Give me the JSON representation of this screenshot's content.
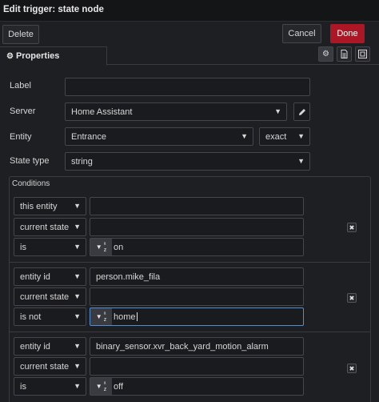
{
  "window": {
    "title": "Edit trigger: state node"
  },
  "toolbar": {
    "delete_label": "Delete",
    "cancel_label": "Cancel",
    "done_label": "Done"
  },
  "tabs": {
    "properties_label": "Properties"
  },
  "form": {
    "label_label": "Label",
    "label_value": "",
    "server_label": "Server",
    "server_value": "Home Assistant",
    "entity_label": "Entity",
    "entity_value": "Entrance",
    "entity_match": "exact",
    "state_type_label": "State type",
    "state_type_value": "string"
  },
  "conditions": {
    "title": "Conditions",
    "groups": [
      {
        "rows": [
          {
            "select": "this entity",
            "value": ""
          },
          {
            "select": "current state",
            "value": ""
          },
          {
            "select": "is",
            "value": "on",
            "type": "az"
          }
        ]
      },
      {
        "rows": [
          {
            "select": "entity id",
            "value": "person.mike_fila"
          },
          {
            "select": "current state",
            "value": ""
          },
          {
            "select": "is not",
            "value": "home",
            "type": "az"
          }
        ]
      },
      {
        "rows": [
          {
            "select": "entity id",
            "value": "binary_sensor.xvr_back_yard_motion_alarm"
          },
          {
            "select": "current state",
            "value": ""
          },
          {
            "select": "is",
            "value": "off",
            "type": "az"
          }
        ]
      }
    ]
  },
  "icons": {
    "gear": "gear-icon",
    "pencil": "pencil-icon",
    "remove": "close-icon",
    "chevron": "chevron-down-icon"
  },
  "colors": {
    "accent_done": "#ad1625",
    "background": "#1e1f22",
    "focus": "#4f8fd6"
  }
}
